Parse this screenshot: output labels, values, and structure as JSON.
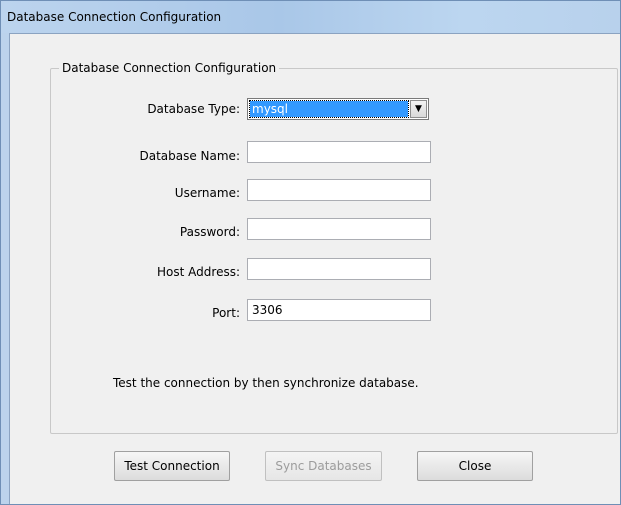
{
  "window": {
    "title": "Database Connection Configuration"
  },
  "group": {
    "title": "Database Connection Configuration"
  },
  "form": {
    "database_type": {
      "label": "Database Type:",
      "value": "mysql"
    },
    "database_name": {
      "label": "Database Name:",
      "value": ""
    },
    "username": {
      "label": "Username:",
      "value": ""
    },
    "password": {
      "label": "Password:",
      "value": ""
    },
    "host_address": {
      "label": "Host Address:",
      "value": ""
    },
    "port": {
      "label": "Port:",
      "value": "3306"
    }
  },
  "hint": "Test the connection by then synchronize database.",
  "buttons": {
    "test": "Test Connection",
    "sync": "Sync Databases",
    "close": "Close"
  },
  "icons": {
    "dropdown": "chevron-down-icon"
  }
}
